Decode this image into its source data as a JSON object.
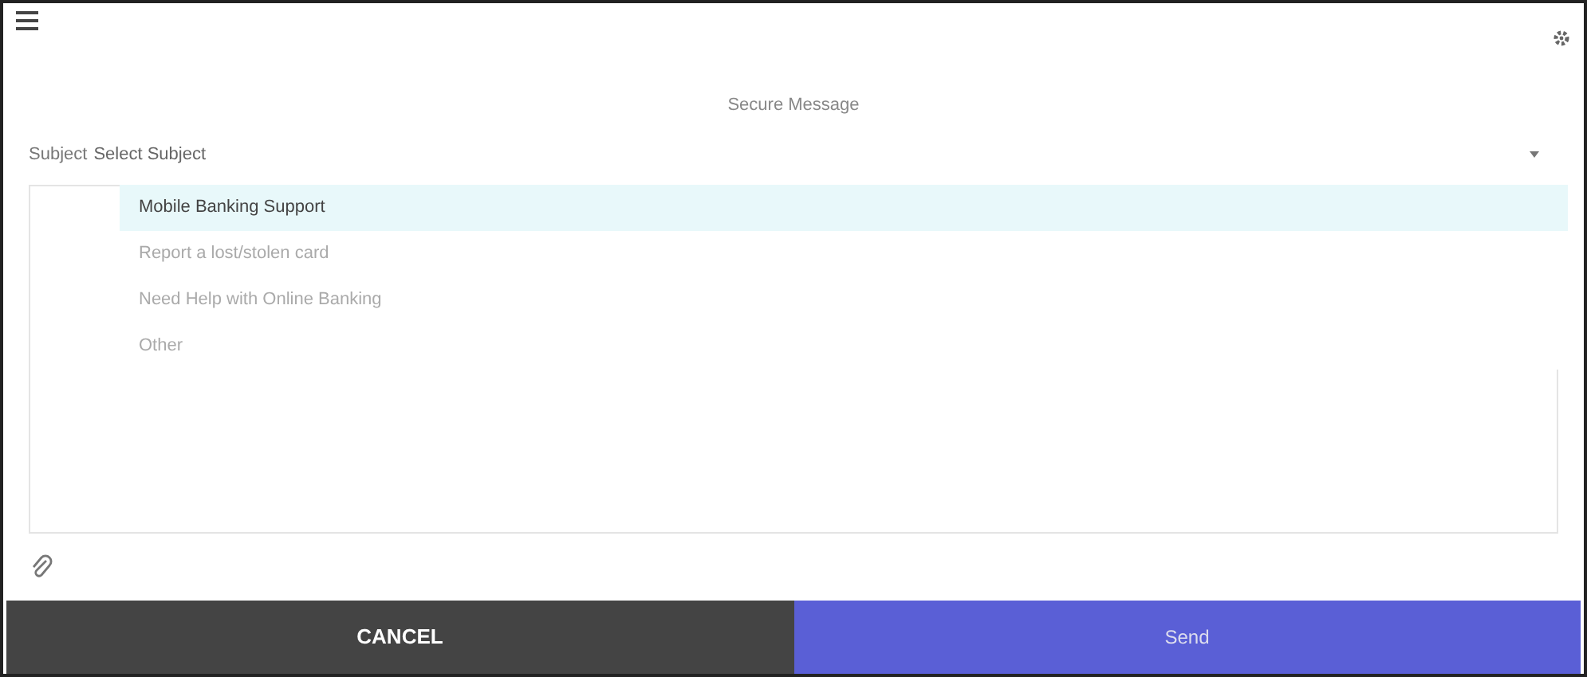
{
  "title": "Secure Message",
  "subject": {
    "label": "Subject",
    "placeholder": "Select Subject",
    "expanded": true
  },
  "options": [
    {
      "label": "Mobile Banking Support",
      "selected": true
    },
    {
      "label": "Report a lost/stolen card",
      "selected": false
    },
    {
      "label": "Need Help with Online Banking",
      "selected": false
    },
    {
      "label": "Other",
      "selected": false
    }
  ],
  "buttons": [
    {
      "label": "CANCEL",
      "kind": "cancel"
    },
    {
      "label": "Send",
      "kind": "send"
    }
  ]
}
